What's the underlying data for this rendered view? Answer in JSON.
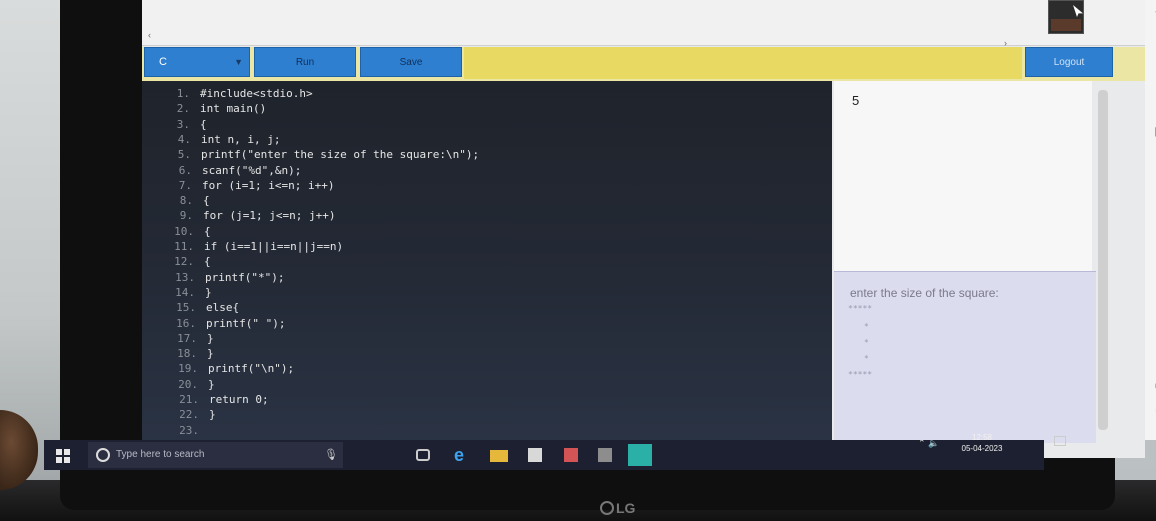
{
  "toolbar": {
    "language": "C",
    "run_label": "Run",
    "save_label": "Save",
    "logout_label": "Logout"
  },
  "editor": {
    "line_numbers": [
      "1.",
      "2.",
      "3.",
      "4.",
      "5.",
      "6.",
      "7.",
      "8.",
      "9.",
      "10.",
      "11.",
      "12.",
      "13.",
      "14.",
      "15.",
      "16.",
      "17.",
      "18.",
      "19.",
      "20.",
      "21.",
      "22.",
      "23."
    ],
    "lines": [
      "#include<stdio.h>",
      "int main()",
      "{",
      "int n, i, j;",
      "printf(\"enter the size of the square:\\n\");",
      "scanf(\"%d\",&n);",
      "for (i=1; i<=n; i++)",
      "{",
      "for (j=1; j<=n; j++)",
      "{",
      "if (i==1||i==n||j==n)",
      "{",
      "printf(\"*\");",
      "}",
      "else{",
      "printf(\" \");",
      "}",
      "}",
      "printf(\"\\n\");",
      "}",
      "return 0;",
      "}",
      ""
    ]
  },
  "output": {
    "input_value": "5",
    "prompt_text": "enter the size of the square:",
    "star_rows": [
      "*****",
      "*",
      "*",
      "*",
      "*****"
    ]
  },
  "taskbar": {
    "search_placeholder": "Type here to search",
    "time": "12:58",
    "date": "05-04-2023"
  },
  "monitor": {
    "brand": "LG"
  },
  "colors": {
    "toolbar_blue": "#2f7fd0",
    "toolbar_yellow": "#e8d963",
    "editor_bg": "#1f232b",
    "console_bg": "#dcdcef"
  }
}
